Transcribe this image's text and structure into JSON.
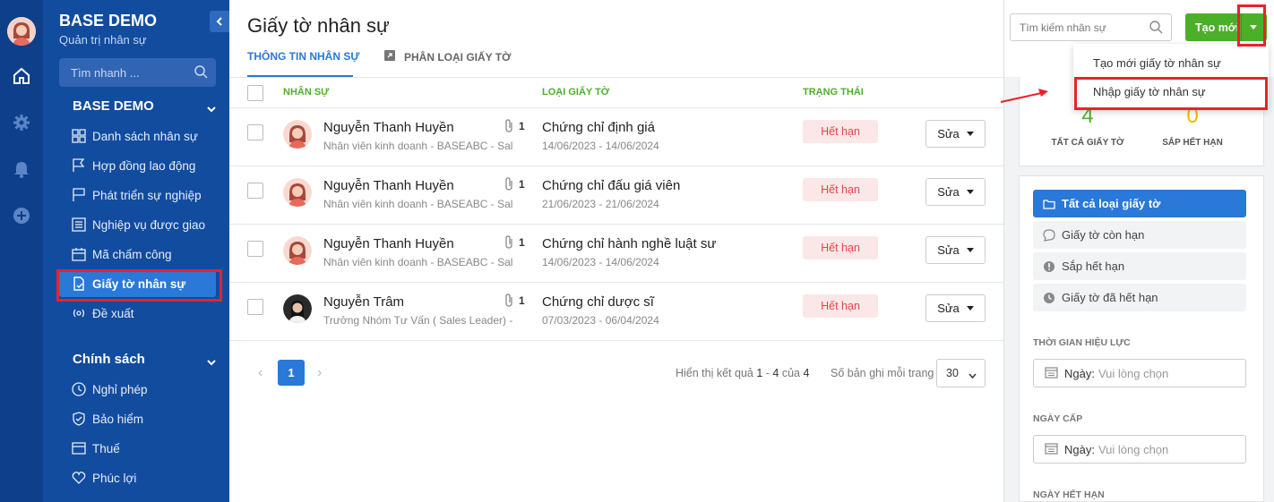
{
  "app": {
    "name": "BASE DEMO",
    "subtitle": "Quản trị nhân sự"
  },
  "sidebar": {
    "search_placeholder": "Tìm nhanh ...",
    "groups": [
      {
        "title": "BASE DEMO",
        "items": [
          {
            "label": "Danh sách nhân sự",
            "icon": "grid-icon"
          },
          {
            "label": "Hợp đồng lao động",
            "icon": "flag-outline-icon"
          },
          {
            "label": "Phát triển sự nghiệp",
            "icon": "flag-icon"
          },
          {
            "label": "Nghiệp vụ được giao",
            "icon": "list-icon"
          },
          {
            "label": "Mã chấm công",
            "icon": "calendar-icon"
          },
          {
            "label": "Giấy tờ nhân sự",
            "icon": "document-icon",
            "active": true
          },
          {
            "label": "Đề xuất",
            "icon": "broadcast-icon"
          }
        ]
      },
      {
        "title": "Chính sách",
        "items": [
          {
            "label": "Nghỉ phép",
            "icon": "clock-icon"
          },
          {
            "label": "Bảo hiểm",
            "icon": "shield-icon"
          },
          {
            "label": "Thuế",
            "icon": "tax-icon"
          },
          {
            "label": "Phúc lợi",
            "icon": "heart-icon"
          }
        ]
      }
    ]
  },
  "page": {
    "title": "Giấy tờ nhân sự",
    "tabs": [
      {
        "label": "THÔNG TIN NHÂN SỰ",
        "active": true
      },
      {
        "label": "PHÂN LOẠI GIẤY TỜ",
        "active": false
      }
    ]
  },
  "table": {
    "headers": [
      "NHÂN SỰ",
      "LOẠI GIẤY TỜ",
      "TRẠNG THÁI"
    ],
    "edit_label": "Sửa",
    "rows": [
      {
        "name": "Nguyễn Thanh Huyền",
        "title": "Nhân viên kinh doanh - BASEABC - Sal...",
        "attachments": "1",
        "doc": "Chứng chỉ định giá",
        "dates": "14/06/2023 - 14/06/2024",
        "status": "Hết hạn"
      },
      {
        "name": "Nguyễn Thanh Huyền",
        "title": "Nhân viên kinh doanh - BASEABC - Sal...",
        "attachments": "1",
        "doc": "Chứng chỉ đấu giá viên",
        "dates": "21/06/2023 - 21/06/2024",
        "status": "Hết hạn"
      },
      {
        "name": "Nguyễn Thanh Huyền",
        "title": "Nhân viên kinh doanh - BASEABC - Sal...",
        "attachments": "1",
        "doc": "Chứng chỉ hành nghề luật sư",
        "dates": "14/06/2023 - 14/06/2024",
        "status": "Hết hạn"
      },
      {
        "name": "Nguyễn Trâm",
        "title": "Trưởng Nhóm Tư Vấn ( Sales Leader) -...",
        "attachments": "1",
        "doc": "Chứng chỉ dược sĩ",
        "dates": "07/03/2023 - 06/04/2024",
        "status": "Hết hạn"
      }
    ]
  },
  "pagination": {
    "current_page": "1",
    "result_prefix": "Hiển thị kết quả ",
    "range_start": "1",
    "range_sep": " - ",
    "range_end": "4",
    "of_word": " của ",
    "total": "4",
    "per_page_label": "Số bản ghi mỗi trang",
    "per_page_value": "30"
  },
  "right_panel": {
    "search_placeholder": "Tìm kiếm nhân sự",
    "create_label": "Tạo mới",
    "dropdown": [
      "Tạo mới giấy tờ nhân sự",
      "Nhập giấy tờ nhân sự"
    ],
    "stats": [
      {
        "value": "4",
        "label": "TẤT CẢ GIẤY TỜ",
        "color": "#4caf2a"
      },
      {
        "value": "0",
        "label": "SẮP HẾT HẠN",
        "color": "#f2b705"
      }
    ],
    "filters": [
      {
        "label": "Tất cả loại giấy tờ",
        "icon": "folder-icon",
        "active": true
      },
      {
        "label": "Giấy tờ còn hạn",
        "icon": "chat-bubble-icon",
        "active": false
      },
      {
        "label": "Sắp hết hạn",
        "icon": "alert-icon",
        "active": false
      },
      {
        "label": "Giấy tờ đã hết hạn",
        "icon": "clock-icon",
        "active": false
      }
    ],
    "date_sections": [
      {
        "label": "THỜI GIAN HIỆU LỰC",
        "prefix": "Ngày:",
        "placeholder": "Vui lòng chọn"
      },
      {
        "label": "NGÀY CẤP",
        "prefix": "Ngày:",
        "placeholder": "Vui lòng chọn"
      },
      {
        "label": "NGÀY HẾT HẠN"
      }
    ]
  },
  "colors": {
    "sidebar_bg": "#124c9f",
    "accent": "#2a78d8",
    "success": "#4caf2a",
    "danger": "#e04848",
    "highlight": "#e6232b"
  }
}
